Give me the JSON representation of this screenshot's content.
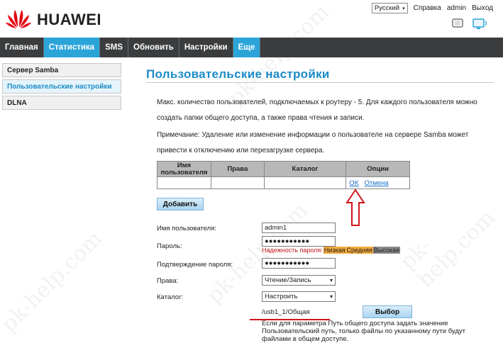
{
  "brand": {
    "name": "HUAWEI"
  },
  "top": {
    "language": "Русский",
    "help": "Справка",
    "user": "admin",
    "logout": "Выход"
  },
  "nav": [
    {
      "label": "Главная"
    },
    {
      "label": "Статистика"
    },
    {
      "label": "SMS"
    },
    {
      "label": "Обновить"
    },
    {
      "label": "Настройки"
    },
    {
      "label": "Еще"
    }
  ],
  "sidebar": [
    {
      "label": "Сервер Samba"
    },
    {
      "label": "Пользовательские настройки"
    },
    {
      "label": "DLNA"
    }
  ],
  "page": {
    "title": "Пользовательские настройки",
    "para1_line1": "Макс. количество пользователей, подключаемых к роутеру - 5. Для каждого пользователя можно",
    "para1_line2": "создать папки общего доступа, а также права чтения и записи.",
    "para2_line1": "Примечание: Удаление или изменение информации о пользователе на сервере Samba может",
    "para2_line2": "привести к отключению или перезагрузке сервера."
  },
  "table": {
    "headers": [
      "Имя пользователя",
      "Права",
      "Каталог",
      "Опции"
    ],
    "ok": "OK",
    "cancel": "Отмена"
  },
  "form": {
    "add_button": "Добавить",
    "username_label": "Имя пользователя:",
    "username_value": "admin1",
    "password_label": "Пароль:",
    "password_value": "●●●●●●●●●●●",
    "strength_label": "Надежность пароля:",
    "strength_low": "Низкая",
    "strength_mid": "Средняя",
    "strength_high": "Высокая",
    "confirm_label": "Подтверждение пароля:",
    "confirm_value": "●●●●●●●●●●●",
    "rights_label": "Права:",
    "rights_value": "Чтение/Запись",
    "catalog_label": "Каталог:",
    "catalog_value": "Настроить",
    "path_value": "/usb1_1/Общая",
    "browse_button": "Выбор",
    "hint": "Если для параметра Путь общего доступа задать значение Пользовательский путь, только файлы по указанному пути будут файлами в общем доступе."
  },
  "colors": {
    "accent": "#2ba5d8",
    "nav_bg": "#3a3c3e",
    "annotation_red": "#d0141c",
    "logo_red": "#e60012"
  },
  "watermark": "pk-help.com"
}
